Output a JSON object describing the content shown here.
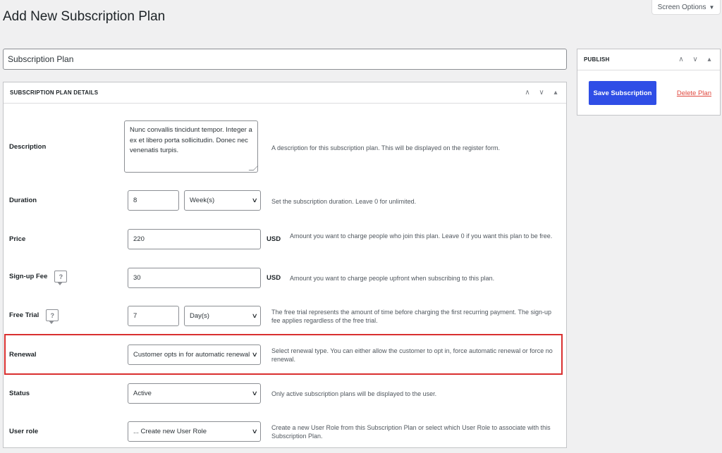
{
  "page": {
    "title": "Add New Subscription Plan"
  },
  "screen_options": {
    "label": "Screen Options",
    "icon": "caret-down-icon"
  },
  "title_field": {
    "value": "Subscription Plan"
  },
  "details_box": {
    "title": "SUBSCRIPTION PLAN DETAILS",
    "handles": [
      "∧",
      "∨",
      "▴"
    ]
  },
  "publish_box": {
    "title": "PUBLISH",
    "handles": [
      "∧",
      "∨",
      "▴"
    ],
    "save_label": "Save Subscription",
    "delete_label": "Delete Plan",
    "accent": "#2f4ee6",
    "danger": "#e0493f"
  },
  "form": {
    "description": {
      "label": "Description",
      "value": "Nunc convallis tincidunt tempor. Integer a ex et libero porta sollicitudin. Donec nec venenatis turpis.",
      "help": "A description for this subscription plan. This will be displayed on the register form."
    },
    "duration": {
      "label": "Duration",
      "value": "8",
      "unit_select": "Week(s)",
      "help": "Set the subscription duration. Leave 0 for unlimited."
    },
    "price": {
      "label": "Price",
      "value": "220",
      "currency": "USD",
      "help": "Amount you want to charge people who join this plan. Leave 0 if you want this plan to be free."
    },
    "signup_fee": {
      "label": "Sign-up Fee",
      "value": "30",
      "currency": "USD",
      "help": "Amount you want to charge people upfront when subscribing to this plan."
    },
    "free_trial": {
      "label": "Free Trial",
      "value": "7",
      "unit_select": "Day(s)",
      "help": "The free trial represents the amount of time before charging the first recurring payment. The sign-up fee applies regardless of the free trial."
    },
    "renewal": {
      "label": "Renewal",
      "select": "Customer opts in for automatic renewal",
      "help": "Select renewal type. You can either allow the customer to opt in, force automatic renewal or force no renewal."
    },
    "status": {
      "label": "Status",
      "select": "Active",
      "help": "Only active subscription plans will be displayed to the user."
    },
    "user_role": {
      "label": "User role",
      "select": "... Create new User Role",
      "help": "Create a new User Role from this Subscription Plan or select which User Role to associate with this Subscription Plan."
    }
  },
  "help_icon_glyph": "?",
  "select_glyph": "∨",
  "highlight_color": "#d92f2f"
}
